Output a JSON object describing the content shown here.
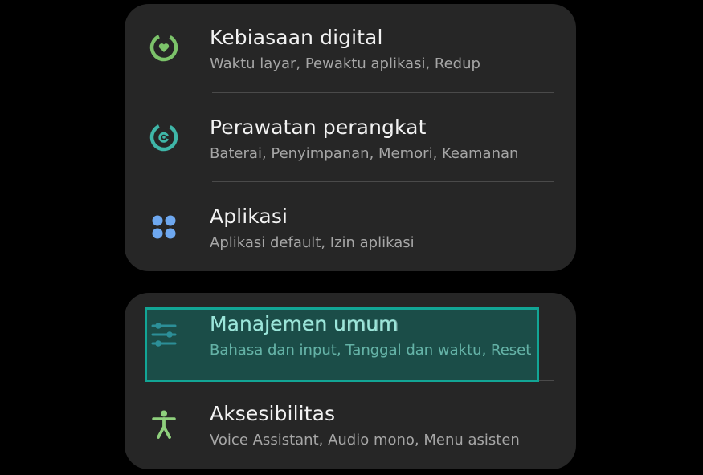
{
  "colors": {
    "background": "#000000",
    "card": "#262626",
    "title_text": "#f2f2f2",
    "subtitle_text": "#a6a6a6",
    "divider": "#4a4a4a",
    "highlight_border": "#12a595",
    "digital_wellbeing_icon": "#7cc36a",
    "device_care_icon": "#3fb6a8",
    "apps_icon": "#6ea8f0",
    "general_management_icon": "#4db8d8",
    "accessibility_icon": "#8fd07d"
  },
  "settings": {
    "group1": [
      {
        "title": "Kebiasaan digital",
        "subtitle": "Waktu layar, Pewaktu aplikasi, Redup",
        "icon": "digital-wellbeing-icon"
      },
      {
        "title": "Perawatan perangkat",
        "subtitle": "Baterai, Penyimpanan, Memori, Keamanan",
        "icon": "device-care-icon"
      },
      {
        "title": "Aplikasi",
        "subtitle": "Aplikasi default, Izin aplikasi",
        "icon": "apps-icon"
      }
    ],
    "group2": [
      {
        "title": "Manajemen umum",
        "subtitle": "Bahasa dan input, Tanggal dan waktu, Reset",
        "icon": "sliders-icon",
        "highlighted": true
      },
      {
        "title": "Aksesibilitas",
        "subtitle": "Voice Assistant, Audio mono, Menu asisten",
        "icon": "accessibility-icon"
      }
    ]
  }
}
